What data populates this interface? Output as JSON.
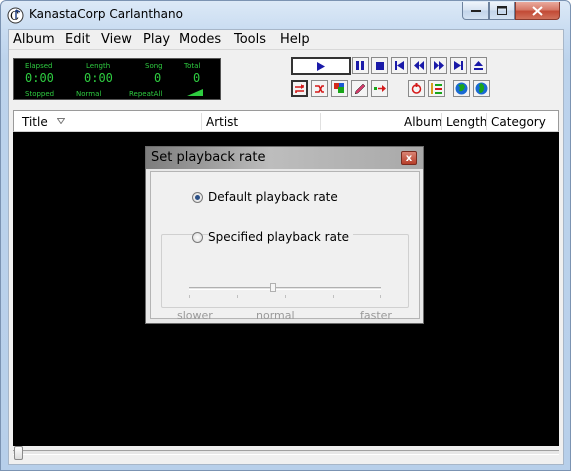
{
  "window": {
    "title": "KanastaCorp Carlanthano"
  },
  "menu": {
    "items": [
      "Album",
      "Edit",
      "View",
      "Play",
      "Modes",
      "Tools",
      "Help"
    ]
  },
  "lcd": {
    "labels": {
      "elapsed": "Elapsed",
      "length": "Length",
      "song": "Song",
      "total": "Total",
      "state": "Stopped",
      "mode": "Normal",
      "repeat": "RepeatAll"
    },
    "values": {
      "elapsed": "0:00",
      "length": "0:00",
      "song": "0",
      "total": "0"
    },
    "color": "#2ecc40"
  },
  "toolbar": {
    "transport": [
      "play-icon",
      "pause-icon",
      "stop-icon",
      "skip-back-icon",
      "rewind-icon",
      "fast-forward-icon",
      "skip-forward-icon",
      "eject-icon"
    ],
    "tools": [
      "repeat-icon",
      "shuffle-icon",
      "colored-blocks-icon",
      "pencil-icon",
      "arrow-right-icon",
      "cycle-icon",
      "list-icon",
      "globe-icon",
      "globe-green-icon"
    ]
  },
  "table": {
    "columns": {
      "title": "Title",
      "artist": "Artist",
      "album": "Album",
      "length": "Length",
      "category": "Category"
    },
    "rows": []
  },
  "seek": {
    "position": 0
  },
  "dialog": {
    "title": "Set playback rate",
    "close_label": "x",
    "options": {
      "default": "Default playback rate",
      "specified": "Specified playback rate"
    },
    "selected": "default",
    "slider": {
      "min_label": "slower",
      "mid_label": "normal",
      "max_label": "faster",
      "value": 0.5
    }
  }
}
